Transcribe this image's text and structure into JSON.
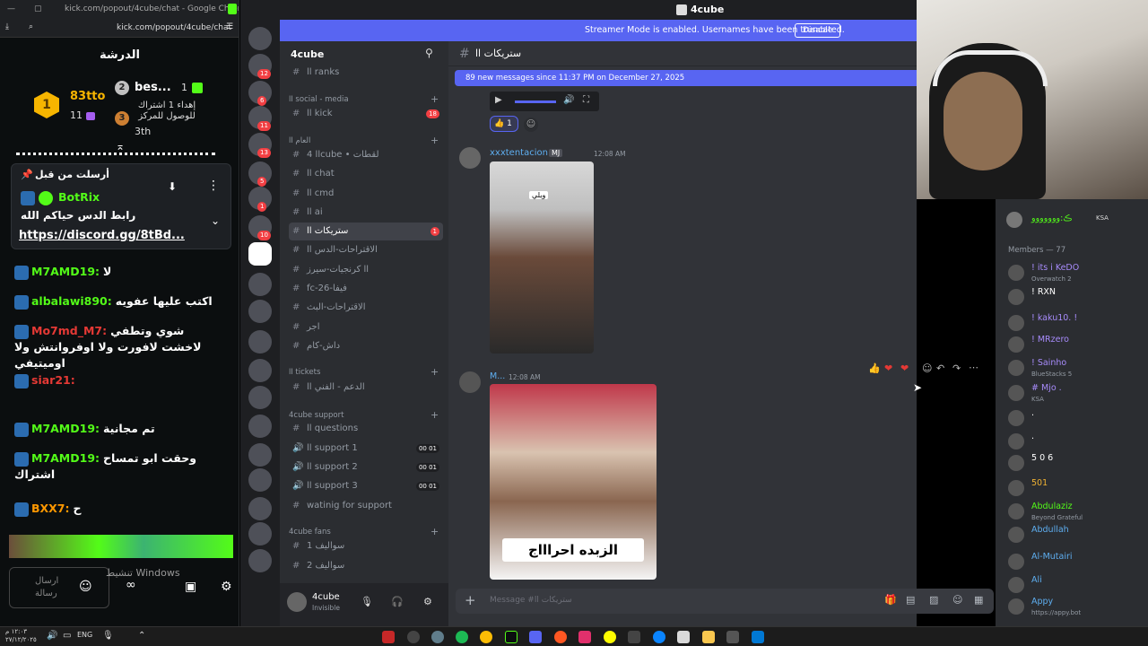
{
  "kick": {
    "title_url": "kick.com/popout/4cube/chat - Google Chrome",
    "address": "kick.com/popout/4cube/chat",
    "header": "الدرشة",
    "leaderboard": {
      "first_name": "83tto",
      "first_count": "11",
      "second_name": "bes...",
      "second_count": "1",
      "third_text": "إهداء 1 اشتراك للوصول للمركز",
      "third_label": "3th"
    },
    "pinned": {
      "label": "أرسلت من قبل",
      "user": "BotRix",
      "text": "رابط الدس حياكم الله",
      "link": "https://discord.gg/8tBd..."
    },
    "messages": [
      {
        "user": "M7AMD19:",
        "text": "لا",
        "color": "#53fc18"
      },
      {
        "user": "albalawi890:",
        "text": "اكتب عليها عفويه",
        "color": "#53fc18"
      },
      {
        "user": "Mo7md_M7:",
        "text": "شوي وتطفي لاخشت لافورت ولا اوفروانتش ولا اوميتيفي",
        "color": "#e53935"
      },
      {
        "user": "siar21:",
        "text": "",
        "color": "#e53935"
      },
      {
        "user": "M7AMD19:",
        "text": "تم مجانية",
        "color": "#53fc18"
      },
      {
        "user": "M7AMD19:",
        "text": "وحقت ابو تمساح اشتراك",
        "color": "#53fc18"
      },
      {
        "user": "BXX7:",
        "text": "ح",
        "color": "#ff9800"
      }
    ],
    "input_placeholder": "ارسال رسالة",
    "watermark": "تنشيط Windows"
  },
  "discord": {
    "window_title": "4cube",
    "streamer_banner": "Streamer Mode is enabled. Usernames have been truncated.",
    "disable_label": "Disable",
    "server_name": "4cube",
    "channel_name": "ستريكات اا",
    "new_messages": "89 new messages since 11:37 PM on December 27, 2025",
    "categories": [
      {
        "label": "اا social - media"
      },
      {
        "label": "العام اا"
      },
      {
        "label": "اا tickets"
      },
      {
        "label": "4cube support"
      },
      {
        "label": "4cube fans"
      }
    ],
    "channels": [
      {
        "name": "اا ranks",
        "badge": ""
      },
      {
        "name": "اا kick",
        "badge": "18"
      },
      {
        "name": "اا 4cube • لقطات",
        "badge": ""
      },
      {
        "name": "اا chat",
        "badge": ""
      },
      {
        "name": "اا cmd",
        "badge": ""
      },
      {
        "name": "اا ai",
        "badge": ""
      },
      {
        "name": "ستريكات اا",
        "badge": "1"
      },
      {
        "name": "الاقتراحات-الدس اا",
        "badge": ""
      },
      {
        "name": "اا كرنجيات-سيرز",
        "badge": ""
      },
      {
        "name": "fc-26-فيفا",
        "badge": ""
      },
      {
        "name": "الاقتراحات-البث",
        "badge": ""
      },
      {
        "name": "اجر",
        "badge": ""
      },
      {
        "name": "داش-كام",
        "badge": ""
      },
      {
        "name": "الدعم - الفني اا",
        "badge": ""
      },
      {
        "name": "اا questions",
        "badge": ""
      },
      {
        "name": "اا support 1",
        "badge": "00 01"
      },
      {
        "name": "اا support 2",
        "badge": "00 01"
      },
      {
        "name": "اا support 3",
        "badge": "00 01"
      },
      {
        "name": "watinig for support",
        "badge": ""
      },
      {
        "name": "سواليف 1",
        "badge": ""
      },
      {
        "name": "سواليف 2",
        "badge": ""
      }
    ],
    "reaction_count": "1",
    "msg1": {
      "user": "xxxtentacion",
      "tag": "MJ",
      "time": "12:08 AM",
      "image_caption": "ويلي"
    },
    "msg2": {
      "user": "M...",
      "time": "12:08 AM",
      "image_caption": "الزبده احراااج"
    },
    "user_panel": {
      "name": "4cube",
      "status": "Invisible"
    },
    "message_placeholder": "Message #ستريكات اا",
    "members_header": "Members — 77",
    "members": [
      {
        "name": "! its i KeDO",
        "sub": "Overwatch 2"
      },
      {
        "name": "! RXN",
        "sub": ""
      },
      {
        "name": "! kaku10. !",
        "sub": ""
      },
      {
        "name": "! MRzero",
        "sub": ""
      },
      {
        "name": "! Sainho",
        "sub": "BlueStacks 5"
      },
      {
        "name": "# Mjo .",
        "sub": "KSA"
      },
      {
        "name": ".",
        "sub": ""
      },
      {
        "name": ".",
        "sub": ""
      },
      {
        "name": "5 0 6",
        "sub": ""
      },
      {
        "name": "501",
        "sub": ""
      },
      {
        "name": "Abdulaziz",
        "sub": "Beyond Grateful"
      },
      {
        "name": "Abdullah",
        "sub": ""
      },
      {
        "name": "Al-Mutairi",
        "sub": ""
      },
      {
        "name": "Ali",
        "sub": ""
      },
      {
        "name": "Appy",
        "sub": "https://appy.bot"
      }
    ],
    "top_member": {
      "name": "ڪ:ووووووو",
      "tag": "KSA"
    },
    "guild_badges": [
      "12",
      "6",
      "11",
      "13",
      "5",
      "1",
      "10"
    ]
  },
  "taskbar": {
    "time": "١٢:٠٣ م",
    "date": "٢٧/١٢/٢٠٢٥",
    "lang": "ENG"
  },
  "colors": {
    "kick_green": "#53fc18",
    "discord_blurple": "#5865f2",
    "discord_bg": "#313338"
  }
}
